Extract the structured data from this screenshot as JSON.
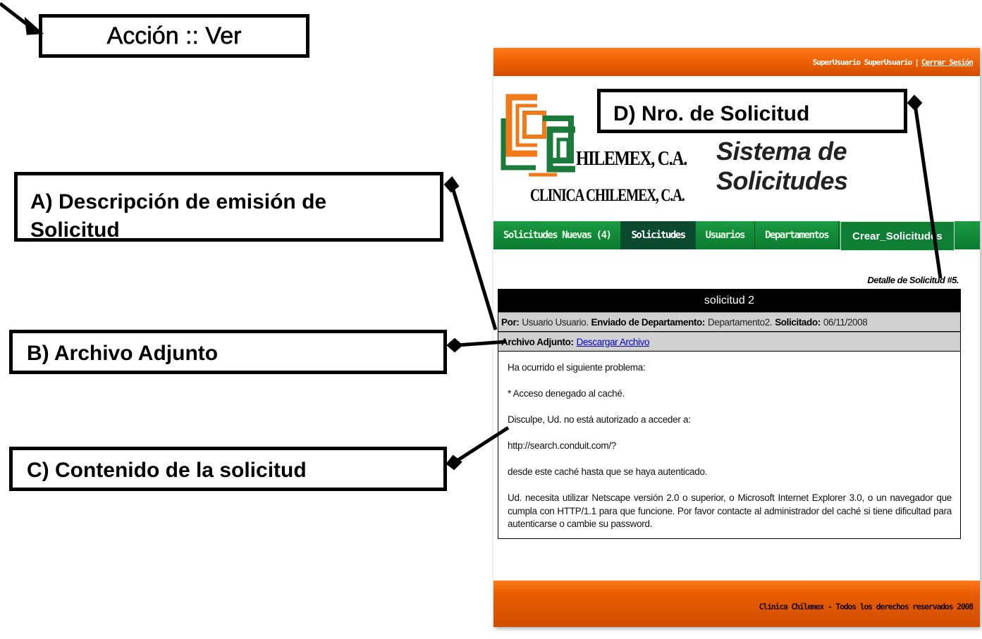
{
  "annotations": {
    "title": "Acción :: Ver",
    "a_line1": "A) Descripción de emisión de",
    "a_line2": "Solicitud",
    "b": "B) Archivo Adjunto",
    "c": "C) Contenido de la solicitud",
    "d": "D) Nro. de Solicitud"
  },
  "header": {
    "user": "SuperUsuario SuperUsuario",
    "separator": "|",
    "logout": "Cerrar Sesión",
    "brand_name": "HILEMEX, C.A.",
    "brand_sub": "CLINICA CHILEMEX, C.A.",
    "system_title": "Sistema de Solicitudes"
  },
  "nav": {
    "items": [
      {
        "label": "Solicitudes Nuevas (4)"
      },
      {
        "label": "Solicitudes"
      },
      {
        "label": "Usuarios"
      },
      {
        "label": "Departamentos"
      },
      {
        "label": "Crear_Solicitudes"
      }
    ]
  },
  "detail": {
    "heading": "Detalle de Solicitud #5.",
    "title": "solicitud 2",
    "por_label": "Por:",
    "por_value": "Usuario Usuario.",
    "dept_label": "Enviado de Departamento:",
    "dept_value": "Departamento2.",
    "fecha_label": "Solicitado:",
    "fecha_value": "06/11/2008",
    "attach_label": "Archivo Adjunto:",
    "attach_link": "Descargar Archivo",
    "body": [
      "Ha ocurrido el siguiente problema:",
      "* Acceso denegado al caché.",
      "Disculpe, Ud. no está autorizado a acceder a:",
      "http://search.conduit.com/?",
      "desde este caché hasta que se haya autenticado.",
      "Ud. necesita utilizar Netscape versión 2.0 o superior, o Microsoft Internet Explorer 3.0, o un navegador que cumpla con HTTP/1.1 para que funcione. Por favor contacte al administrador del caché si tiene dificultad para autenticarse o cambie su password."
    ]
  },
  "footer": {
    "text": "Clínica Chilemex - Todos los derechos reservados 2008"
  },
  "colors": {
    "orange": "#e85c00",
    "green": "#0c7a30",
    "logo_orange": "#f07a1a",
    "logo_green": "#1a7a3a"
  }
}
